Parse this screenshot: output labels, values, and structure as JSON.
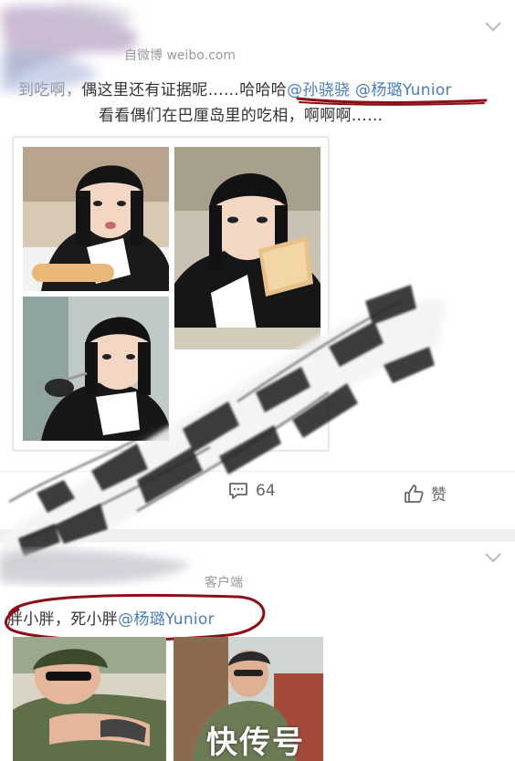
{
  "post1": {
    "source_prefix": "自微博",
    "source": "weibo.com",
    "line1_prefix": "到吃啊，",
    "line1_text": "偶这里还有证据呢……哈哈哈",
    "mention_a": "@孙骁骁",
    "mention_b": "@杨璐Yunior",
    "line2": "看看偶们在巴厘岛里的吃相，啊啊啊……",
    "comment_count": "64",
    "like_label": "赞"
  },
  "post2": {
    "source_suffix": "客户端",
    "text": "胖小胖，死小胖",
    "mention": "@杨璐Yunior"
  },
  "watermark": "快传号",
  "icons": {
    "menu": "chevron-down-icon",
    "comment": "comment-icon",
    "like": "thumbs-up-icon"
  },
  "colors": {
    "mention": "#4a7cc0",
    "annotation": "#8b0f14",
    "text": "#333333"
  }
}
